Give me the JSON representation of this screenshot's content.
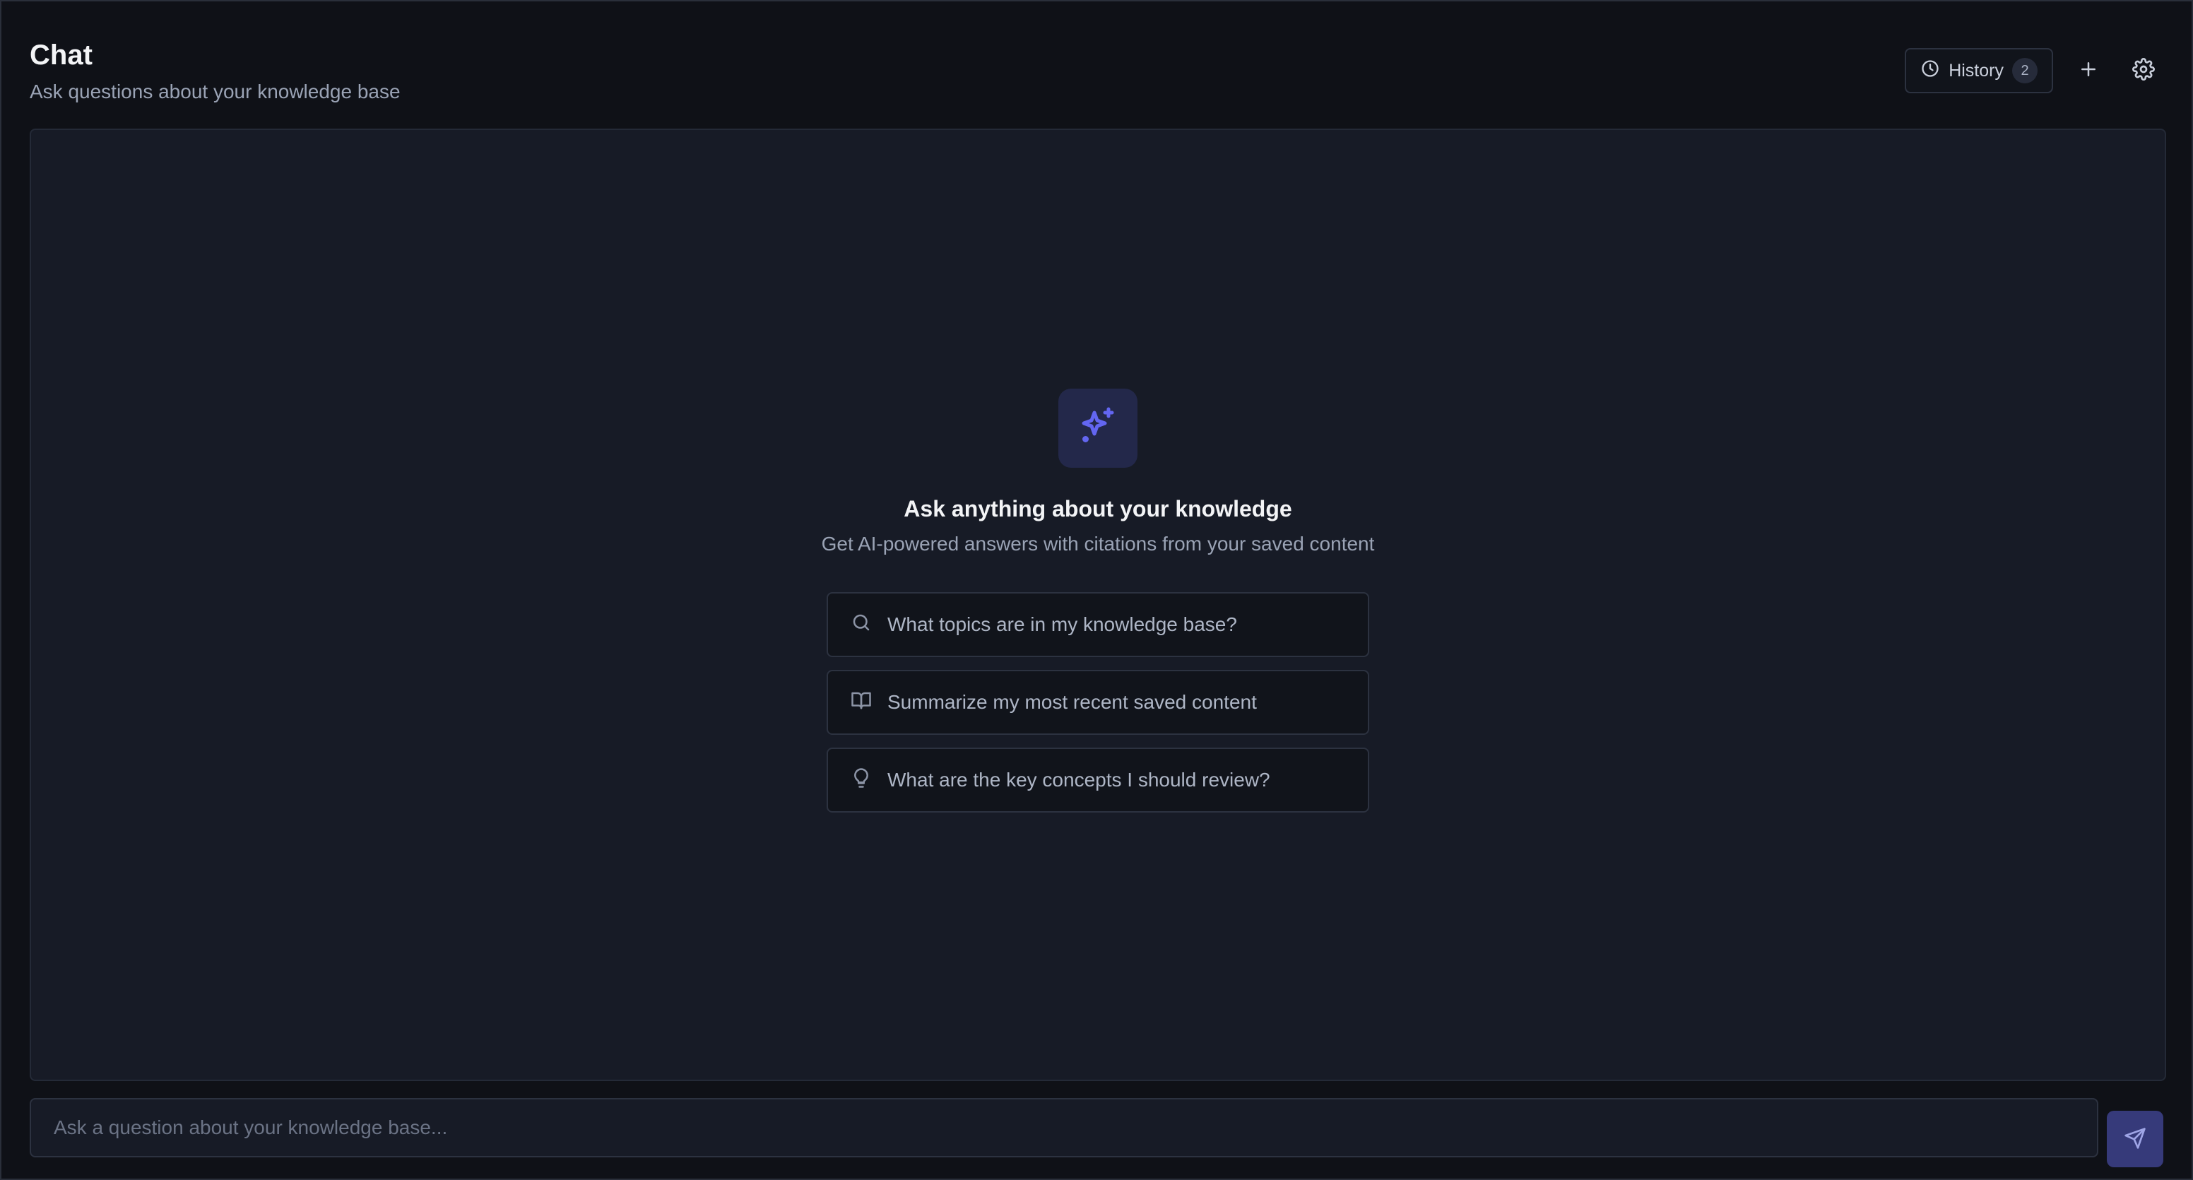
{
  "header": {
    "title": "Chat",
    "subtitle": "Ask questions about your knowledge base",
    "history_label": "History",
    "history_count": "2",
    "new_icon": "plus-icon",
    "settings_icon": "gear-icon"
  },
  "empty_state": {
    "icon": "sparkles-icon",
    "title": "Ask anything about your knowledge",
    "subtitle": "Get AI-powered answers with citations from your saved content"
  },
  "suggestions": [
    {
      "icon": "search-icon",
      "label": "What topics are in my knowledge base?"
    },
    {
      "icon": "book-open-icon",
      "label": "Summarize my most recent saved content"
    },
    {
      "icon": "lightbulb-icon",
      "label": "What are the key concepts I should review?"
    }
  ],
  "composer": {
    "placeholder": "Ask a question about your knowledge base...",
    "value": "",
    "send_icon": "send-icon"
  },
  "colors": {
    "background": "#0f1117",
    "panel": "#171b26",
    "accent": "#6366f1",
    "accent_bg": "#23284a"
  }
}
